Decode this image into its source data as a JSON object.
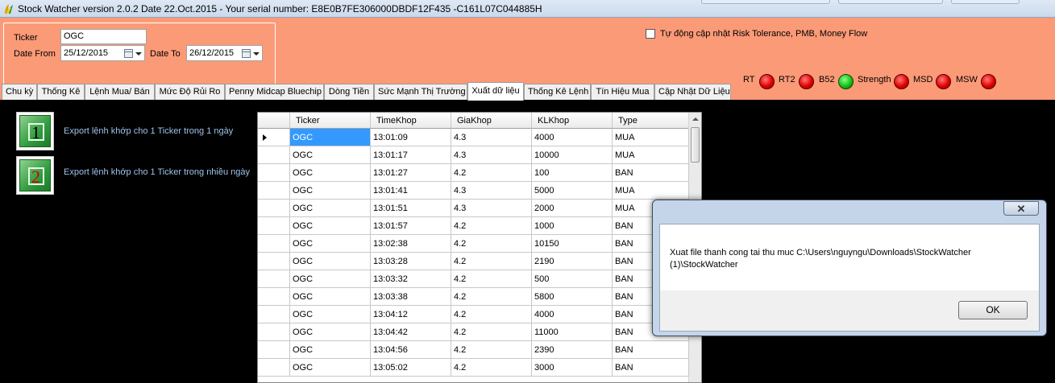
{
  "window": {
    "title": "Stock Watcher version 2.0.2 Date 22.Oct.2015 - Your serial number: E8E0B7FE306000DBDF12F435 -C161L07C044885H"
  },
  "filters": {
    "ticker_label": "Ticker",
    "ticker_value": "OGC",
    "date_from_label": "Date From",
    "date_from_value": "25/12/2015",
    "date_to_label": "Date To",
    "date_to_value": "26/12/2015",
    "auto_update_label": "Tự động cập nhật Risk Tolerance, PMB, Money Flow",
    "auto_update_checked": false
  },
  "indicators": [
    {
      "label": "RT",
      "color": "#e20000"
    },
    {
      "label": "RT2",
      "color": "#e20000"
    },
    {
      "label": "B52",
      "color": "#14c014"
    },
    {
      "label": "Strength",
      "color": "#e20000"
    },
    {
      "label": "MSD",
      "color": "#e20000"
    },
    {
      "label": "MSW",
      "color": "#e20000"
    }
  ],
  "tabs": [
    {
      "label": "Chu kỳ"
    },
    {
      "label": "Thống Kê"
    },
    {
      "label": "Lệnh Mua/ Bán"
    },
    {
      "label": "Mức Độ Rủi Ro"
    },
    {
      "label": "Penny Midcap Bluechip"
    },
    {
      "label": "Dòng Tiền"
    },
    {
      "label": "Sức Mạnh Thị Trường"
    },
    {
      "label": "Xuất dữ liệu",
      "active": true
    },
    {
      "label": "Thống Kê Lệnh"
    },
    {
      "label": "Tín Hiệu Mua"
    },
    {
      "label": "Cập Nhật Dữ Liệu"
    }
  ],
  "export_options": [
    {
      "number": "1",
      "label": "Export lệnh khớp cho 1 Ticker trong 1 ngày"
    },
    {
      "number": "2",
      "label": "Export lệnh khớp cho 1 Ticker trong nhiều ngày"
    }
  ],
  "grid": {
    "columns": [
      "Ticker",
      "TimeKhop",
      "GiaKhop",
      "KLKhop",
      "Type"
    ],
    "rows": [
      [
        "OGC",
        "13:01:09",
        "4.3",
        "4000",
        "MUA"
      ],
      [
        "OGC",
        "13:01:17",
        "4.3",
        "10000",
        "MUA"
      ],
      [
        "OGC",
        "13:01:27",
        "4.2",
        "100",
        "BAN"
      ],
      [
        "OGC",
        "13:01:41",
        "4.3",
        "5000",
        "MUA"
      ],
      [
        "OGC",
        "13:01:51",
        "4.3",
        "2000",
        "MUA"
      ],
      [
        "OGC",
        "13:01:57",
        "4.2",
        "1000",
        "BAN"
      ],
      [
        "OGC",
        "13:02:38",
        "4.2",
        "10150",
        "BAN"
      ],
      [
        "OGC",
        "13:03:28",
        "4.2",
        "2190",
        "BAN"
      ],
      [
        "OGC",
        "13:03:32",
        "4.2",
        "500",
        "BAN"
      ],
      [
        "OGC",
        "13:03:38",
        "4.2",
        "5800",
        "BAN"
      ],
      [
        "OGC",
        "13:04:12",
        "4.2",
        "4000",
        "BAN"
      ],
      [
        "OGC",
        "13:04:42",
        "4.2",
        "11000",
        "BAN"
      ],
      [
        "OGC",
        "13:04:56",
        "4.2",
        "2390",
        "BAN"
      ],
      [
        "OGC",
        "13:05:02",
        "4.2",
        "3000",
        "BAN"
      ]
    ],
    "selected_row": 0
  },
  "dialog": {
    "close_glyph": "✕",
    "message": "Xuat file thanh cong tai thu muc C:\\Users\\nguyngu\\Downloads\\StockWatcher (1)\\StockWatcher",
    "ok_label": "OK"
  },
  "colors": {
    "header_bg": "#fb9a77",
    "content_bg": "#000000",
    "selection": "#3399ff",
    "export_label": "#9ec3ec"
  }
}
